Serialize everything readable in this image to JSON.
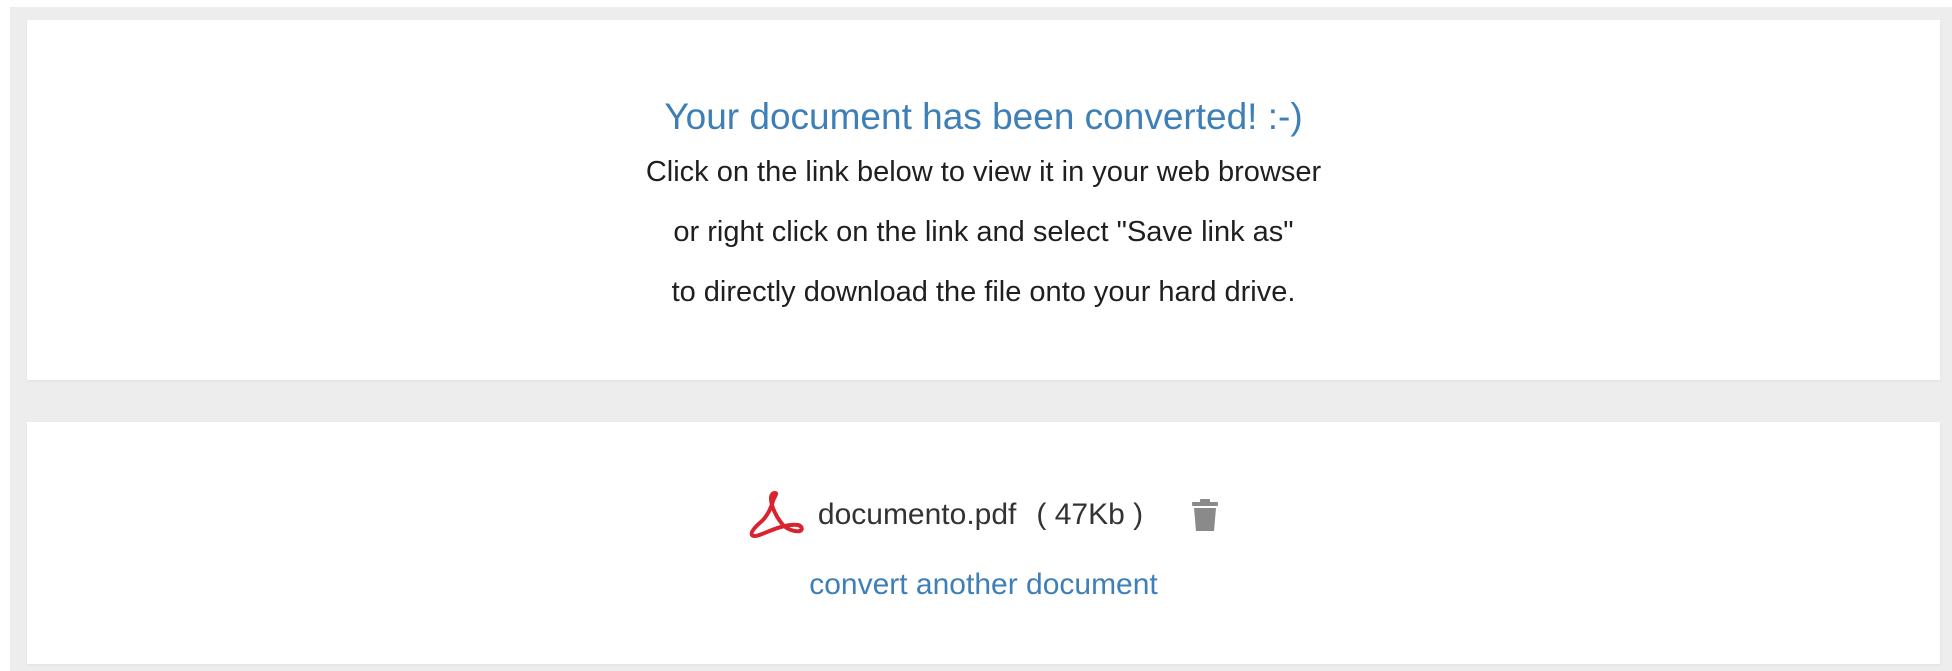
{
  "result": {
    "headline": "Your document has been converted! :-)",
    "message_lines": [
      "Click on the link below to view it in your web browser",
      "or right click on the link and select \"Save link as\"",
      "to directly download the file onto your hard drive."
    ]
  },
  "file": {
    "name": "documento.pdf",
    "size_label": "( 47Kb )",
    "icon": "pdf-icon",
    "delete_icon": "trash-icon"
  },
  "actions": {
    "convert_another_label": "convert another document"
  },
  "colors": {
    "accent": "#3d7fb6",
    "pdf_red": "#d9232f",
    "background": "#ededed",
    "card": "#ffffff",
    "text": "#1f1f1f",
    "icon_gray": "#8a8a8a"
  }
}
